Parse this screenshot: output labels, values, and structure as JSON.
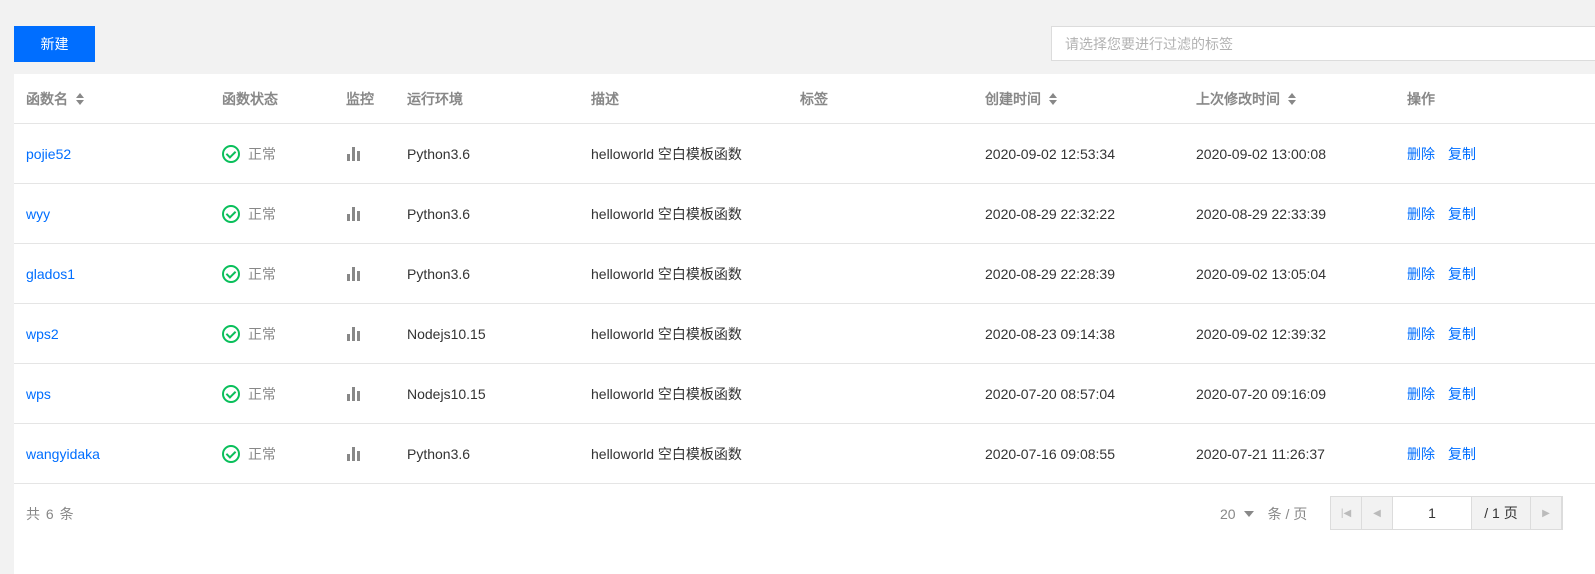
{
  "toolbar": {
    "new_label": "新建",
    "filter_placeholder": "请选择您要进行过滤的标签"
  },
  "table": {
    "headers": {
      "name": "函数名",
      "status": "函数状态",
      "monitor": "监控",
      "runtime": "运行环境",
      "desc": "描述",
      "tags": "标签",
      "created": "创建时间",
      "modified": "上次修改时间",
      "ops": "操作"
    },
    "rows": [
      {
        "name": "pojie52",
        "status": "正常",
        "runtime": "Python3.6",
        "desc": "helloworld 空白模板函数",
        "created": "2020-09-02 12:53:34",
        "modified": "2020-09-02 13:00:08"
      },
      {
        "name": "wyy",
        "status": "正常",
        "runtime": "Python3.6",
        "desc": "helloworld 空白模板函数",
        "created": "2020-08-29 22:32:22",
        "modified": "2020-08-29 22:33:39"
      },
      {
        "name": "glados1",
        "status": "正常",
        "runtime": "Python3.6",
        "desc": "helloworld 空白模板函数",
        "created": "2020-08-29 22:28:39",
        "modified": "2020-09-02 13:05:04"
      },
      {
        "name": "wps2",
        "status": "正常",
        "runtime": "Nodejs10.15",
        "desc": "helloworld 空白模板函数",
        "created": "2020-08-23 09:14:38",
        "modified": "2020-09-02 12:39:32"
      },
      {
        "name": "wps",
        "status": "正常",
        "runtime": "Nodejs10.15",
        "desc": "helloworld 空白模板函数",
        "created": "2020-07-20 08:57:04",
        "modified": "2020-07-20 09:16:09"
      },
      {
        "name": "wangyidaka",
        "status": "正常",
        "runtime": "Python3.6",
        "desc": "helloworld 空白模板函数",
        "created": "2020-07-16 09:08:55",
        "modified": "2020-07-21 11:26:37"
      }
    ],
    "ops": {
      "delete": "删除",
      "copy": "复制"
    }
  },
  "footer": {
    "total": "共 6 条",
    "page_size": "20",
    "page_size_unit": "条 / 页",
    "current_page": "1",
    "total_pages": "/ 1 页"
  },
  "colors": {
    "primary": "#006eff",
    "success": "#0abf5b"
  }
}
